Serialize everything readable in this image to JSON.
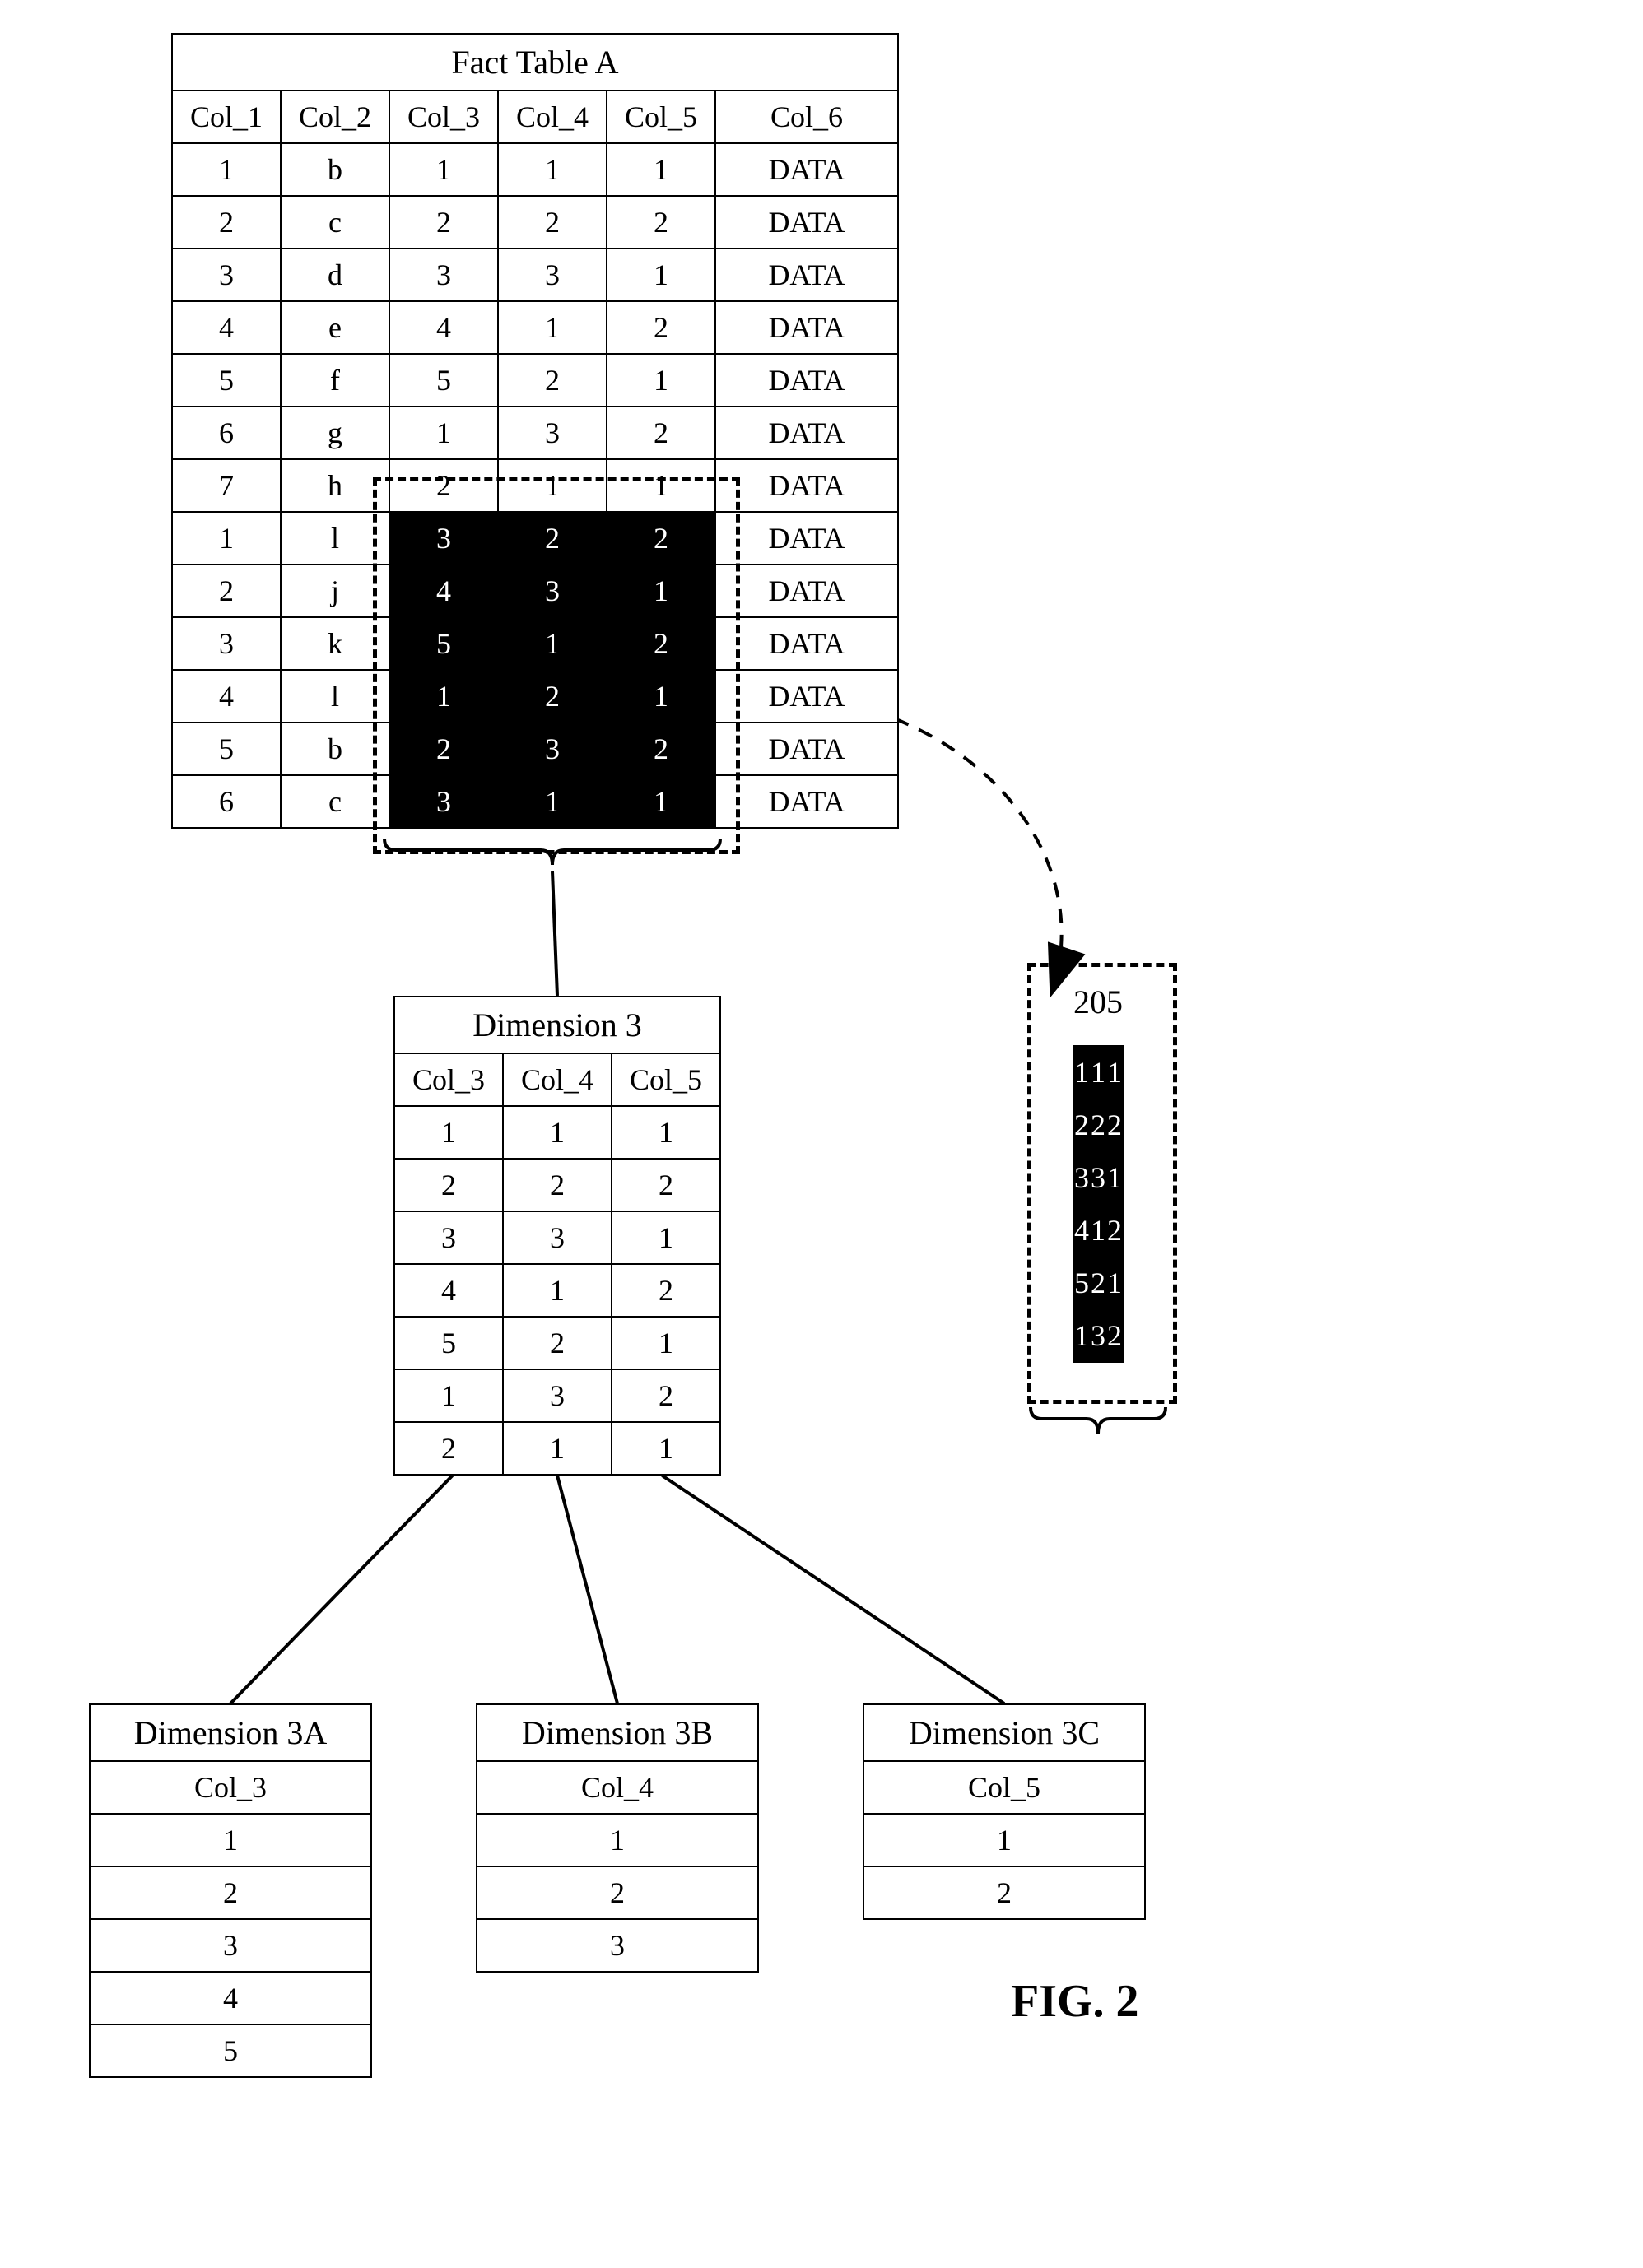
{
  "factTable": {
    "title": "Fact Table A",
    "headers": [
      "Col_1",
      "Col_2",
      "Col_3",
      "Col_4",
      "Col_5",
      "Col_6"
    ],
    "rows": [
      [
        "1",
        "b",
        "1",
        "1",
        "1",
        "DATA"
      ],
      [
        "2",
        "c",
        "2",
        "2",
        "2",
        "DATA"
      ],
      [
        "3",
        "d",
        "3",
        "3",
        "1",
        "DATA"
      ],
      [
        "4",
        "e",
        "4",
        "1",
        "2",
        "DATA"
      ],
      [
        "5",
        "f",
        "5",
        "2",
        "1",
        "DATA"
      ],
      [
        "6",
        "g",
        "1",
        "3",
        "2",
        "DATA"
      ],
      [
        "7",
        "h",
        "2",
        "1",
        "1",
        "DATA"
      ],
      [
        "1",
        "l",
        "3",
        "2",
        "2",
        "DATA"
      ],
      [
        "2",
        "j",
        "4",
        "3",
        "1",
        "DATA"
      ],
      [
        "3",
        "k",
        "5",
        "1",
        "2",
        "DATA"
      ],
      [
        "4",
        "l",
        "1",
        "2",
        "1",
        "DATA"
      ],
      [
        "5",
        "b",
        "2",
        "3",
        "2",
        "DATA"
      ],
      [
        "6",
        "c",
        "3",
        "1",
        "1",
        "DATA"
      ]
    ],
    "highlight": {
      "rowStart": 7,
      "rowEnd": 12,
      "colStart": 2,
      "colEnd": 4
    }
  },
  "dim3": {
    "title": "Dimension 3",
    "headers": [
      "Col_3",
      "Col_4",
      "Col_5"
    ],
    "rows": [
      [
        "1",
        "1",
        "1"
      ],
      [
        "2",
        "2",
        "2"
      ],
      [
        "3",
        "3",
        "1"
      ],
      [
        "4",
        "1",
        "2"
      ],
      [
        "5",
        "2",
        "1"
      ],
      [
        "1",
        "3",
        "2"
      ],
      [
        "2",
        "1",
        "1"
      ]
    ]
  },
  "dim3A": {
    "title": "Dimension 3A",
    "header": "Col_3",
    "vals": [
      "1",
      "2",
      "3",
      "4",
      "5"
    ]
  },
  "dim3B": {
    "title": "Dimension 3B",
    "header": "Col_4",
    "vals": [
      "1",
      "2",
      "3"
    ]
  },
  "dim3C": {
    "title": "Dimension 3C",
    "header": "Col_5",
    "vals": [
      "1",
      "2"
    ]
  },
  "box205": {
    "label": "205",
    "rows": [
      [
        "1",
        "1",
        "1"
      ],
      [
        "2",
        "2",
        "2"
      ],
      [
        "3",
        "3",
        "1"
      ],
      [
        "4",
        "1",
        "2"
      ],
      [
        "5",
        "2",
        "1"
      ],
      [
        "1",
        "3",
        "2"
      ]
    ]
  },
  "figLabel": "FIG. 2"
}
